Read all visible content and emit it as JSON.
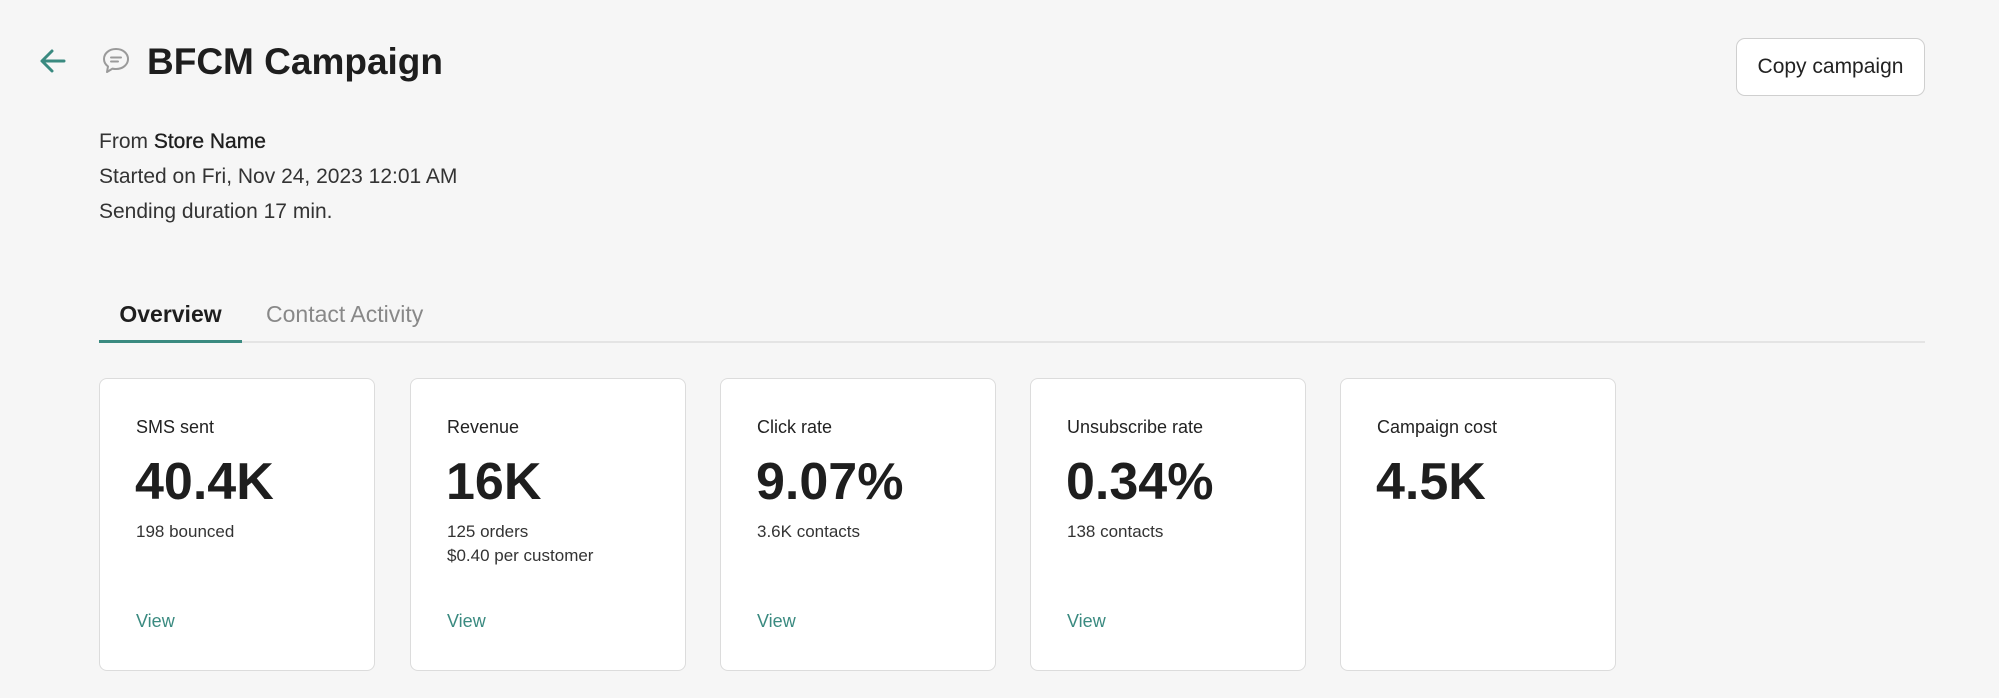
{
  "header": {
    "title": "BFCM Campaign",
    "back_icon": "arrow-left-icon",
    "title_icon": "chat-bubble-icon",
    "copy_label": "Copy campaign"
  },
  "meta": {
    "from_prefix": "From",
    "from_name": "Store Name",
    "started": "Started on Fri, Nov 24, 2023 12:01 AM",
    "duration": "Sending duration 17 min."
  },
  "tabs": [
    {
      "label": "Overview",
      "active": true
    },
    {
      "label": "Contact Activity",
      "active": false
    }
  ],
  "cards": [
    {
      "label": "SMS sent",
      "value": "40.4K",
      "sub1": "198 bounced",
      "sub2": "",
      "view": "View"
    },
    {
      "label": "Revenue",
      "value": "16K",
      "sub1": "125 orders",
      "sub2": "$0.40 per customer",
      "view": "View"
    },
    {
      "label": "Click rate",
      "value": "9.07%",
      "sub1": "3.6K contacts",
      "sub2": "",
      "view": "View"
    },
    {
      "label": "Unsubscribe rate",
      "value": "0.34%",
      "sub1": "138 contacts",
      "sub2": "",
      "view": "View"
    },
    {
      "label": "Campaign cost",
      "value": "4.5K",
      "sub1": "",
      "sub2": "",
      "view": ""
    }
  ],
  "colors": {
    "accent": "#3a8a80",
    "background": "#f6f6f6",
    "card": "#ffffff",
    "border": "#dcdcdc"
  }
}
